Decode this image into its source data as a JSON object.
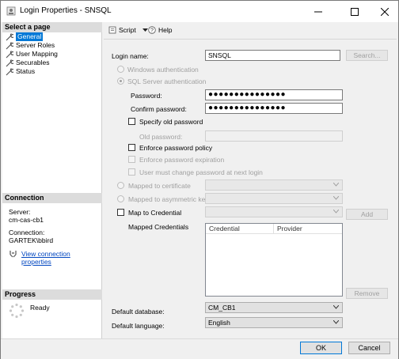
{
  "window": {
    "title": "Login Properties - SNSQL"
  },
  "left": {
    "select_page_header": "Select a page",
    "pages": [
      {
        "label": "General"
      },
      {
        "label": "Server Roles"
      },
      {
        "label": "User Mapping"
      },
      {
        "label": "Securables"
      },
      {
        "label": "Status"
      }
    ],
    "connection_header": "Connection",
    "server_label": "Server:",
    "server_value": "cm-cas-cb1",
    "connection_label": "Connection:",
    "connection_value": "GARTEK\\bbird",
    "view_connection_link": "View connection properties",
    "progress_header": "Progress",
    "progress_status": "Ready"
  },
  "toolbar": {
    "script_label": "Script",
    "help_label": "Help"
  },
  "form": {
    "login_name_label": "Login name:",
    "login_name_value": "SNSQL",
    "search_button": "Search...",
    "windows_auth_label": "Windows authentication",
    "sql_auth_label": "SQL Server authentication",
    "password_label": "Password:",
    "password_value": "●●●●●●●●●●●●●●●",
    "confirm_password_label": "Confirm password:",
    "confirm_password_value": "●●●●●●●●●●●●●●●",
    "specify_old_password_label": "Specify old password",
    "old_password_label": "Old password:",
    "enforce_policy_label": "Enforce password policy",
    "enforce_expiration_label": "Enforce password expiration",
    "must_change_label": "User must change password at next login",
    "mapped_cert_label": "Mapped to certificate",
    "mapped_asym_label": "Mapped to asymmetric key",
    "map_credential_label": "Map to Credential",
    "add_button": "Add",
    "mapped_credentials_label": "Mapped Credentials",
    "grid_columns": [
      "Credential",
      "Provider"
    ],
    "remove_button": "Remove",
    "default_database_label": "Default database:",
    "default_database_value": "CM_CB1",
    "default_language_label": "Default language:",
    "default_language_value": "English"
  },
  "footer": {
    "ok_label": "OK",
    "cancel_label": "Cancel"
  }
}
